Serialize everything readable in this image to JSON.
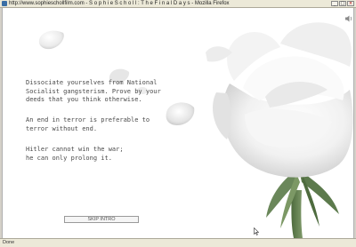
{
  "window": {
    "title": "http://www.sophieschollfilm.com - S o p h i e   S c h o l l :   T h e   F i n a l   D a y s - Mozilla Firefox",
    "minimize": "_",
    "maximize": "□",
    "close": "×"
  },
  "page": {
    "quotes": [
      {
        "line1": "Dissociate yourselves from National",
        "line2": "Socialist gangsterism. Prove by your",
        "line3": "deeds that you think otherwise."
      },
      {
        "line1": "An end in terror is preferable to",
        "line2": "terror without end."
      },
      {
        "line1": "Hitler cannot win the war;",
        "line2": "he can only prolong it."
      }
    ],
    "skip_intro_label": "SKIP INTRO",
    "speaker_icon": "speaker-icon",
    "rose_icon": "white-rose-image"
  },
  "status": {
    "text": "Done"
  },
  "colors": {
    "background": "#ffffff",
    "text": "#4a4a4a",
    "chrome": "#ece9d8"
  }
}
